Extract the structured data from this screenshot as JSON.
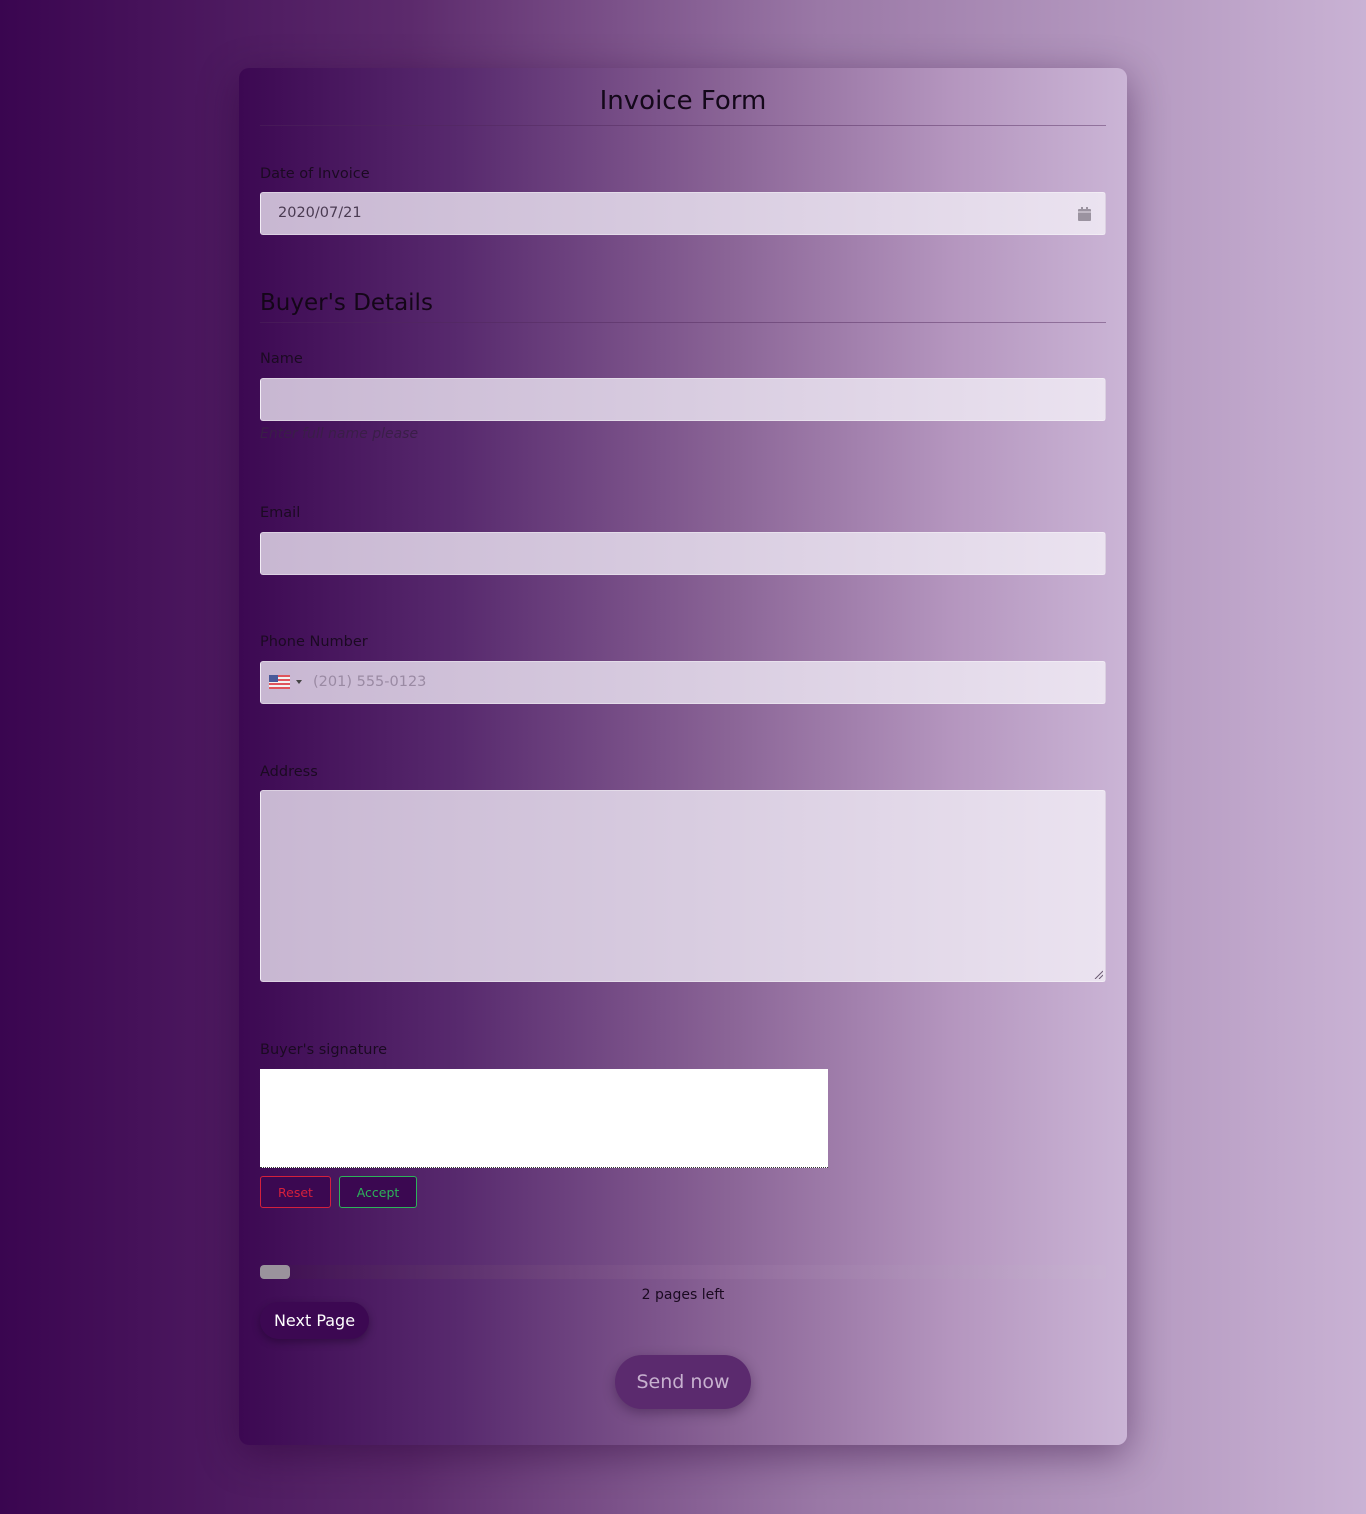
{
  "form": {
    "title": "Invoice Form",
    "date": {
      "label": "Date of Invoice",
      "value": "2020/07/21",
      "icon": "calendar-icon"
    },
    "buyer_section": {
      "title": "Buyer's Details",
      "name": {
        "label": "Name",
        "value": "",
        "hint": "Enter full name please"
      },
      "email": {
        "label": "Email",
        "value": ""
      },
      "phone": {
        "label": "Phone Number",
        "country_flag": "us-flag-icon",
        "placeholder": "(201) 555-0123",
        "value": ""
      },
      "address": {
        "label": "Address",
        "value": ""
      },
      "signature": {
        "label": "Buyer's signature",
        "reset_label": "Reset",
        "accept_label": "Accept"
      }
    },
    "progress": {
      "fraction": 0.035,
      "status_text": "2 pages left"
    },
    "next_page_label": "Next Page",
    "send_label": "Send now"
  },
  "colors": {
    "reset": "#d4203c",
    "accept": "#2db35a",
    "button_dark": "#3c0852",
    "send_button": "#5b2a6e"
  }
}
